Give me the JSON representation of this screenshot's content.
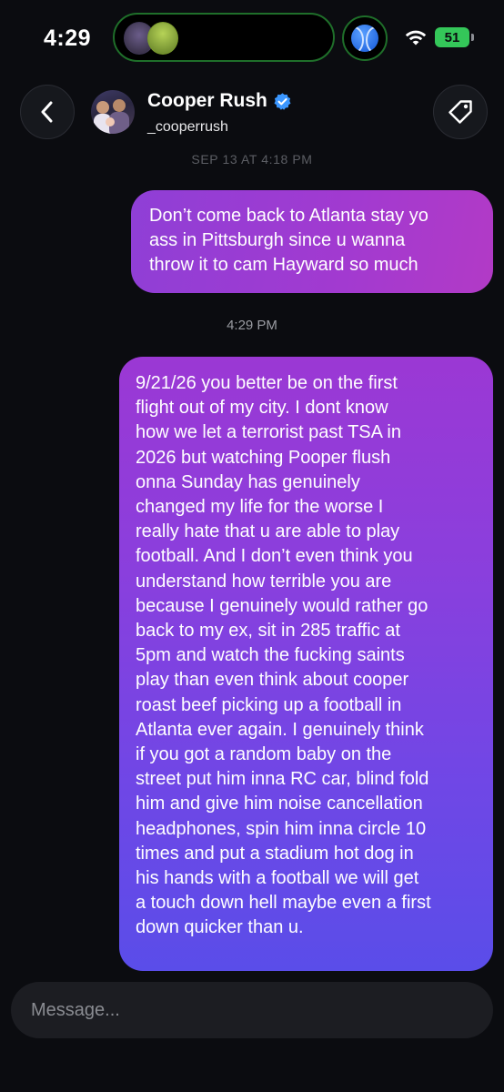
{
  "status_bar": {
    "time": "4:29",
    "battery": "51",
    "island_icon": "dual-avatar-icon",
    "app_icon": "baseball-icon",
    "wifi_icon": "wifi-icon"
  },
  "header": {
    "name": "Cooper Rush",
    "handle": "_cooperrush",
    "verified": true,
    "back_icon": "chevron-left-icon",
    "tag_icon": "tag-icon"
  },
  "conversation": {
    "timestamp_1": "SEP 13 AT 4:18 PM",
    "message_1": "Don’t come back to Atlanta stay yo\nass in Pittsburgh since u wanna\nthrow it to cam Hayward so much",
    "timestamp_2": "4:29 PM",
    "message_2": "9/21/26 you better be on the first\nflight out of my city. I dont know\nhow we let a terrorist past TSA in\n2026 but watching Pooper flush\nonna Sunday has genuinely\nchanged my life for the worse I\nreally hate that u are able to play\nfootball. And I don’t even think you\nunderstand how terrible you are\nbecause I genuinely would rather go\nback to my ex, sit in 285 traffic at\n5pm and watch the fucking saints\nplay than even think about cooper\nroast beef picking up a football in\nAtlanta ever again. I genuinely think\nif you got a random baby on the\nstreet put him inna RC car, blind fold\nhim and give him noise cancellation\nheadphones, spin him inna circle 10\ntimes and put a stadium hot dog in\nhis hands with a football we will get\na touch down hell maybe even a first\ndown quicker than u."
  },
  "composer": {
    "placeholder": "Message..."
  },
  "colors": {
    "background": "#0b0c10",
    "bubble_top": "#9b38d4",
    "bubble_bottom": "#5a4de9",
    "verified_blue": "#3b97ff",
    "battery_green": "#34c759"
  }
}
